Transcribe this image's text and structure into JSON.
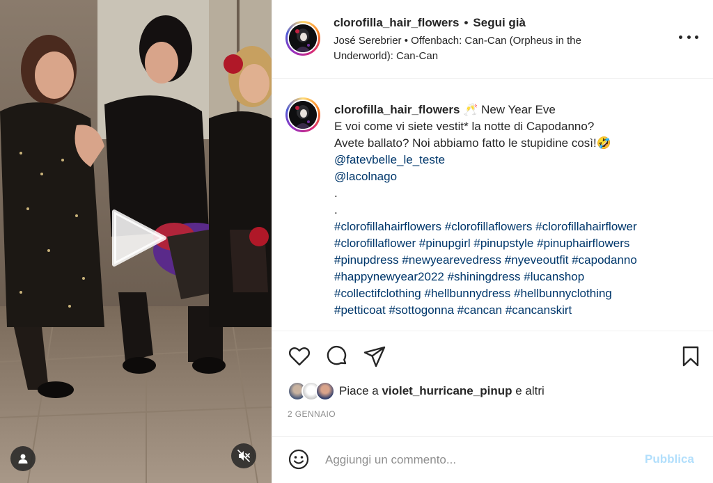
{
  "post": {
    "username": "clorofilla_hair_flowers",
    "separator": "•",
    "follow_label": "Segui già",
    "music": "José Serebrier • Offenbach: Can-Can (Orpheus in the Underworld): Can-Can"
  },
  "caption": {
    "username": "clorofilla_hair_flowers",
    "line1": " 🥂 New Year Eve",
    "line2": "E voi come vi siete vestit* la notte di Capodanno?",
    "line3": "Avete ballato? Noi abbiamo fatto le stupidine così!🤣",
    "mentions": [
      "@fatevbelle_le_teste",
      "@lacolnago"
    ],
    "dots": [
      ".",
      "."
    ],
    "hashtag_lines": [
      [
        "#clorofillahairflowers",
        "#clorofillaflowers",
        "#clorofillahairflower"
      ],
      [
        "#clorofillaflower",
        "#pinupgirl",
        "#pinupstyle",
        "#pinuphairflowers"
      ],
      [
        "#pinupdress",
        "#newyearevedress",
        "#nyeveoutfit",
        "#capodanno"
      ],
      [
        "#happynewyear2022",
        "#shiningdress",
        "#lucanshop"
      ],
      [
        "#collectifclothing",
        "#hellbunnydress",
        "#hellbunnyclothing"
      ],
      [
        "#petticoat",
        "#sottogonna",
        "#cancan",
        "#cancanskirt"
      ]
    ]
  },
  "likes": {
    "prefix": "Piace a ",
    "user": "violet_hurricane_pinup",
    "suffix": " e altri"
  },
  "date": "2 GENNAIO",
  "comment": {
    "placeholder": "Aggiungi un commento...",
    "publish_label": "Pubblica"
  },
  "icons": {
    "like": "heart-icon",
    "comment": "comment-bubble-icon",
    "share": "paper-plane-icon",
    "save": "bookmark-icon",
    "emoji": "smiley-icon",
    "more": "more-horizontal-icon",
    "play": "play-icon",
    "user_tag": "person-icon",
    "mute": "muted-speaker-icon"
  },
  "colors": {
    "link": "#00376b",
    "publish_disabled": "#b2dffc",
    "muted_text": "#8e8e8e"
  }
}
